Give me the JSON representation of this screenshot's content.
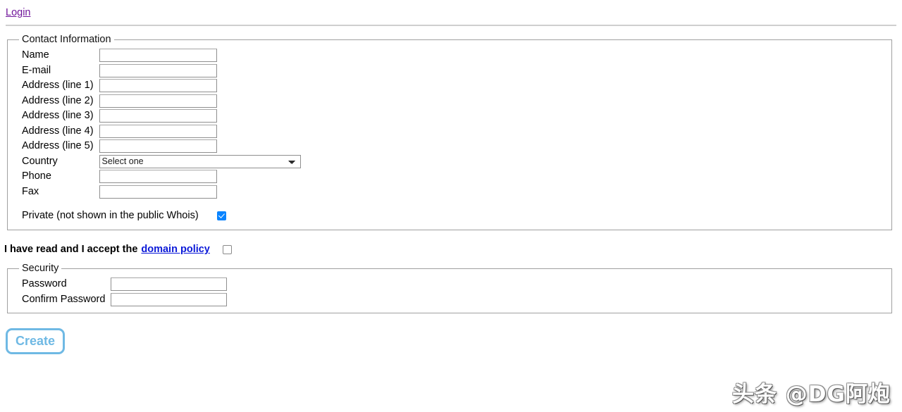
{
  "header": {
    "login_label": "Login"
  },
  "contact": {
    "legend": "Contact Information",
    "fields": [
      {
        "label": "Name",
        "value": "",
        "type": "text"
      },
      {
        "label": "E-mail",
        "value": "",
        "type": "text"
      },
      {
        "label": "Address (line 1)",
        "value": "",
        "type": "text"
      },
      {
        "label": "Address (line 2)",
        "value": "",
        "type": "text"
      },
      {
        "label": "Address (line 3)",
        "value": "",
        "type": "text"
      },
      {
        "label": "Address (line 4)",
        "value": "",
        "type": "text"
      },
      {
        "label": "Address (line 5)",
        "value": "",
        "type": "text"
      },
      {
        "label": "Country",
        "value": "Select one",
        "type": "select"
      },
      {
        "label": "Phone",
        "value": "",
        "type": "text"
      },
      {
        "label": "Fax",
        "value": "",
        "type": "text"
      }
    ],
    "country_selected": "Select one",
    "private_label": "Private (not shown in the public Whois)",
    "private_checked": true
  },
  "policy": {
    "text": "I have read and I accept the",
    "link_label": "domain policy",
    "accepted": false
  },
  "security": {
    "legend": "Security",
    "fields": [
      {
        "label": "Password",
        "value": ""
      },
      {
        "label": "Confirm Password",
        "value": ""
      }
    ]
  },
  "actions": {
    "create_label": "Create"
  },
  "watermark": {
    "text": "头条 @DG阿炮"
  },
  "colors": {
    "login_link": "#70169a",
    "policy_link": "#0b19d8",
    "checkbox_checked": "#0a84ff",
    "create_accent": "#6fb9e4",
    "fieldset_border": "#a0a0a0"
  }
}
